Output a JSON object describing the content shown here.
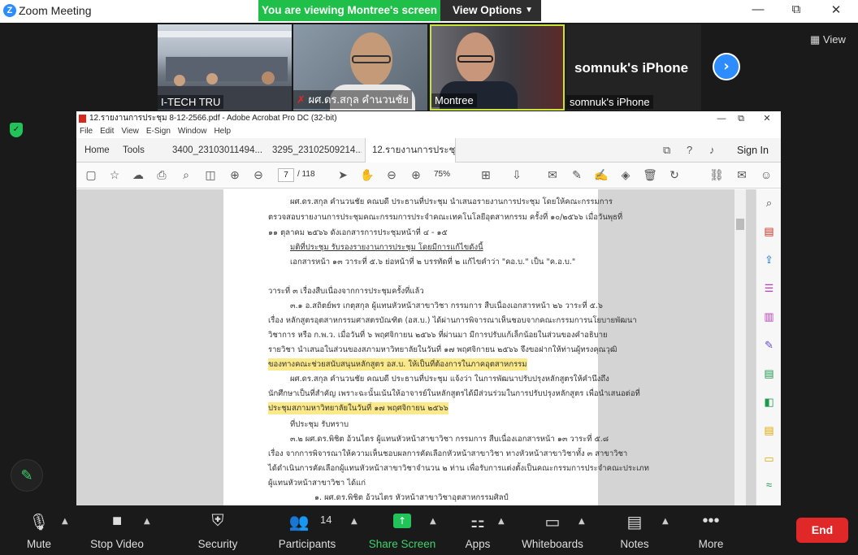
{
  "window": {
    "title": "Zoom Meeting",
    "logo": "Z",
    "min": "—",
    "restore": "⧉",
    "close": "✕"
  },
  "banner": {
    "viewing": "You are viewing Montree's screen",
    "options": "View Options"
  },
  "participants": [
    {
      "name": "I-TECH TRU"
    },
    {
      "name": "ผศ.ดร.สกุล  คำนวนชัย"
    },
    {
      "name": "Montree"
    },
    {
      "name": "somnuk's iPhone",
      "big": "somnuk's iPhone"
    }
  ],
  "view_label": "View",
  "acrobat": {
    "title": "12.รายงานการประชุม 8-12-2566.pdf - Adobe Acrobat Pro DC (32-bit)",
    "menu": [
      "File",
      "Edit",
      "View",
      "E-Sign",
      "Window",
      "Help"
    ],
    "tabs": {
      "home": "Home",
      "tools": "Tools",
      "t1": "3400_23103011494...",
      "t2": "3295_23102509214...",
      "t3": "12.รายงานการประชุ..."
    },
    "signin": "Sign In",
    "page_current": "7",
    "page_total": "/ 118",
    "zoom": "75%",
    "lines": [
      "ผศ.ดร.สกุล  คำนวนชัย คณบดี ประธานที่ประชุม นำเสนอรายงานการประชุม โดยให้คณะกรรมการ",
      "ตรวจสอบรายงานการประชุมคณะกรรมการประจำคณะเทคโนโลยีอุตสาหกรรม ครั้งที่ ๑๐/๒๕๖๖ เมื่อวันพุธที่",
      "๑๑ ตุลาคม  ๒๕๖๖ ดังเอกสารการประชุมหน้าที่ ๔ - ๑๕",
      "มติที่ประชุม  รับรองรายงานการประชุม โดยมีการแก้ไขดังนี้",
      "เอกสารหน้า ๑๓ วาระที่ ๕.๖ ย่อหน้าที่ ๒ บรรทัดที่ ๒ แก้ไขคำว่า \"คอ.บ.\" เป็น \"ค.อ.บ.\"",
      "วาระที่ ๓  เรื่องสืบเนื่องจากการประชุมครั้งที่แล้ว",
      "๓.๑ อ.สถิตย์พร  เกตุสกุล ผู้แทนหัวหน้าสาขาวิชา กรรมการ สืบเนื่องเอกสารหน้า ๒๖ วาระที่ ๕.๖",
      "เรื่อง หลักสูตรอุตสาหกรรมศาสตรบัณฑิต (อส.บ.) ได้ผ่านการพิจารณาเห็นชอบจากคณะกรรมการนโยบายพัฒนา",
      "วิชาการ หรือ ก.พ.ว. เมื่อวันที่ ๖ พฤศจิกายน ๒๕๖๖ ที่ผ่านมา มีการปรับแก้เล็กน้อยในส่วนของคำอธิบาย",
      "รายวิชา นำเสนอในส่วนของสภามหาวิทยาลัยในวันที่ ๑๗ พฤศจิกายน ๒๕๖๖ จึงขอฝากให้ท่านผู้ทรงคุณวุฒิ",
      "ของทางคณะช่วยสนับสนุนหลักสูตร อส.บ. ให้เป็นที่ต้องการในภาคอุตสาหกรรม",
      "ผศ.ดร.สกุล  คำนวนชัย คณบดี ประธานที่ประชุม แจ้งว่า ในการพัฒนาปรับปรุงหลักสูตรให้คำนึงถึง",
      "นักศึกษาเป็นที่สำคัญ เพราะฉะนั้นเน้นให้อาจารย์ในหลักสูตรได้มีส่วนร่วมในการปรับปรุงหลักสูตร เพื่อนำเสนอต่อที่",
      "ประชุมสภามหาวิทยาลัยในวันที่ ๑๗ พฤศจิกายน ๒๕๖๖",
      "ที่ประชุม รับทราบ",
      "๓.๒ ผศ.ดร.พิชิต   อ้วนไตร ผู้แทนหัวหน้าสาขาวิชา กรรมการ สืบเนื่องเอกสารหน้า ๑๓ วาระที่ ๕.๘",
      "เรื่อง จากการพิจารณาให้ความเห็นชอบผลการคัดเลือกหัวหน้าสาขาวิชา ทางหัวหน้าสาขาวิชาทั้ง ๓ สาขาวิชา",
      "ได้ดำเนินการคัดเลือกผู้แทนหัวหน้าสาขาวิชาจำนวน ๒ ท่าน เพื่อรับการแต่งตั้งเป็นคณะกรรมการประจำคณะประเภท",
      "ผู้แทนหัวหน้าสาขาวิชา ได้แก่",
      "๑. ผศ.ดร.พิชิต     อ้วนไตร    หัวหน้าสาขาวิชาอุตสาหกรรมศิลป์"
    ]
  },
  "toolbar": {
    "mute": "Mute",
    "video": "Stop Video",
    "security": "Security",
    "participants": "Participants",
    "participants_count": "14",
    "share": "Share Screen",
    "apps": "Apps",
    "whiteboards": "Whiteboards",
    "notes": "Notes",
    "more": "More",
    "end": "End"
  },
  "colors": {
    "accent": "#2d8cff",
    "green": "#22c35a",
    "end": "#e02828",
    "highlight": "#fbe98a"
  }
}
